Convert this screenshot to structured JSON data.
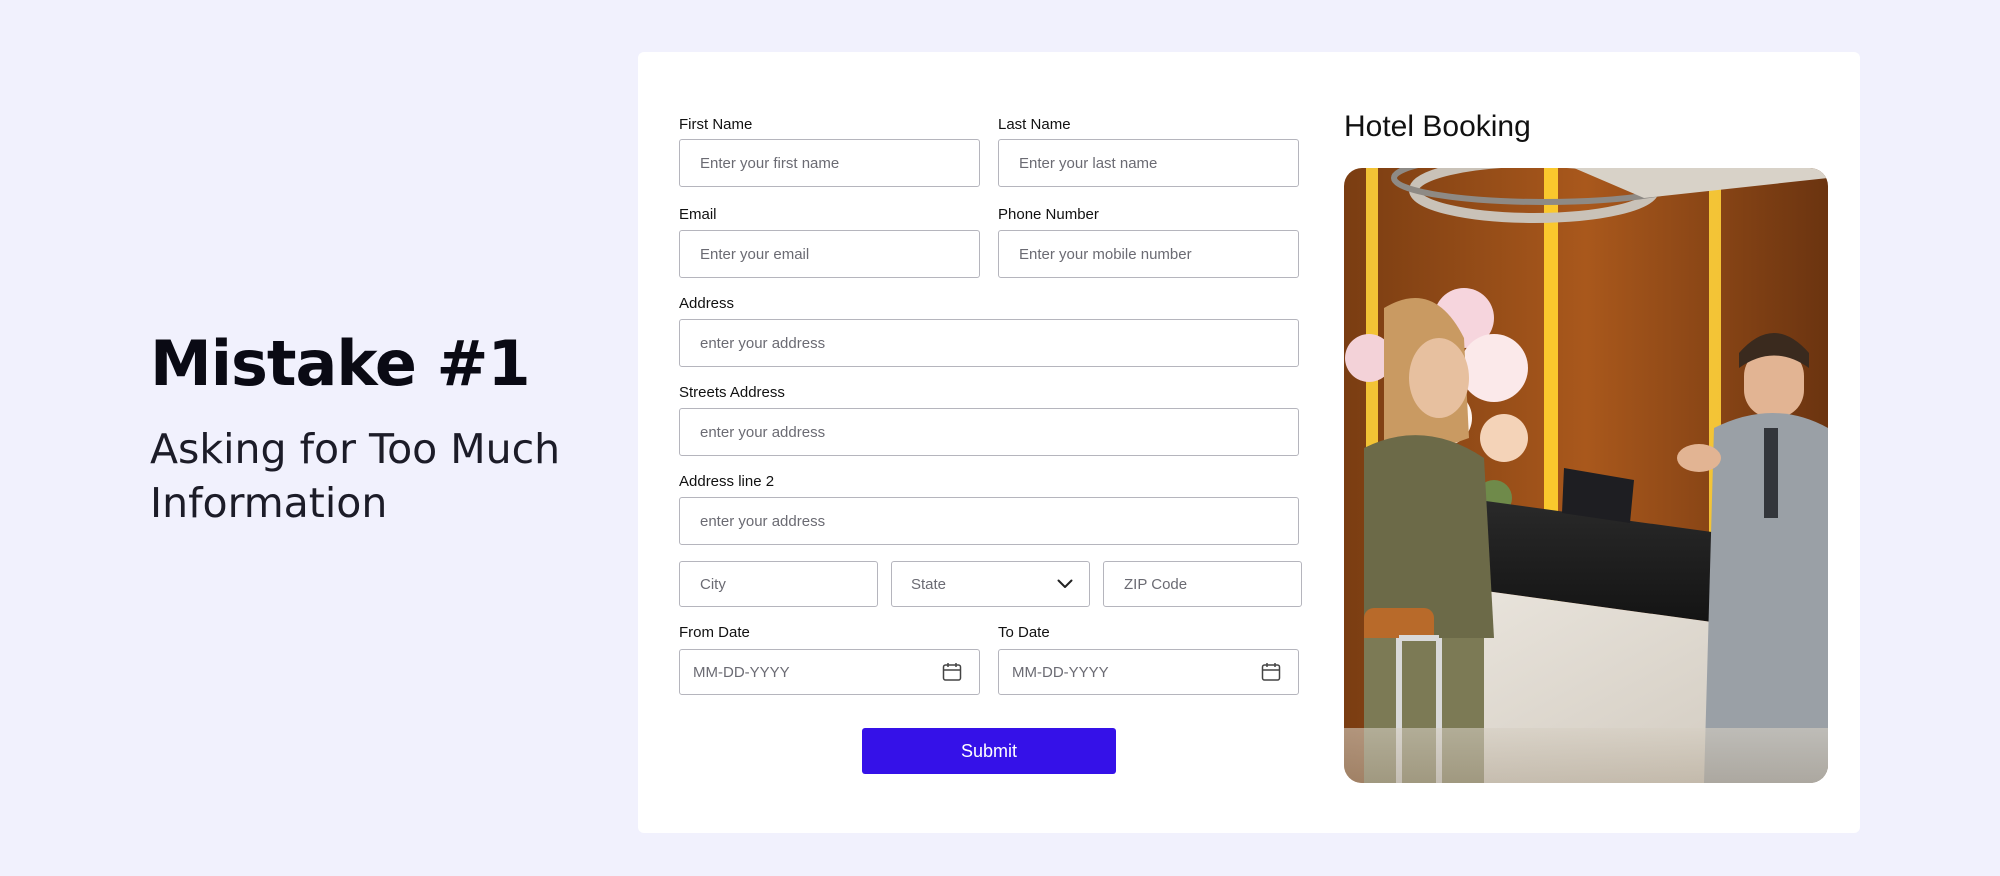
{
  "heading": "Mistake #1",
  "subheading": "Asking for Too Much Information",
  "form": {
    "title": "Hotel Booking",
    "first_name": {
      "label": "First Name",
      "placeholder": "Enter your first name"
    },
    "last_name": {
      "label": "Last Name",
      "placeholder": "Enter your last name"
    },
    "email": {
      "label": "Email",
      "placeholder": "Enter your email"
    },
    "phone": {
      "label": "Phone Number",
      "placeholder": "Enter your mobile number"
    },
    "address": {
      "label": "Address",
      "placeholder": "enter your address"
    },
    "street": {
      "label": "Streets Address",
      "placeholder": "enter your address"
    },
    "address2": {
      "label": "Address line 2",
      "placeholder": "enter your address"
    },
    "city": {
      "placeholder": "City"
    },
    "state": {
      "value": "State"
    },
    "zip": {
      "placeholder": "ZIP Code"
    },
    "from_date": {
      "label": "From Date",
      "placeholder": "MM-DD-YYYY"
    },
    "to_date": {
      "label": "To Date",
      "placeholder": "MM-DD-YYYY"
    },
    "submit_label": "Submit"
  },
  "colors": {
    "background": "#f1f1fd",
    "card": "#ffffff",
    "submit": "#3511e8",
    "border": "#b5b5bd"
  },
  "icons": {
    "state": "chevron-down-icon",
    "from_date": "calendar-icon",
    "to_date": "calendar-icon"
  }
}
